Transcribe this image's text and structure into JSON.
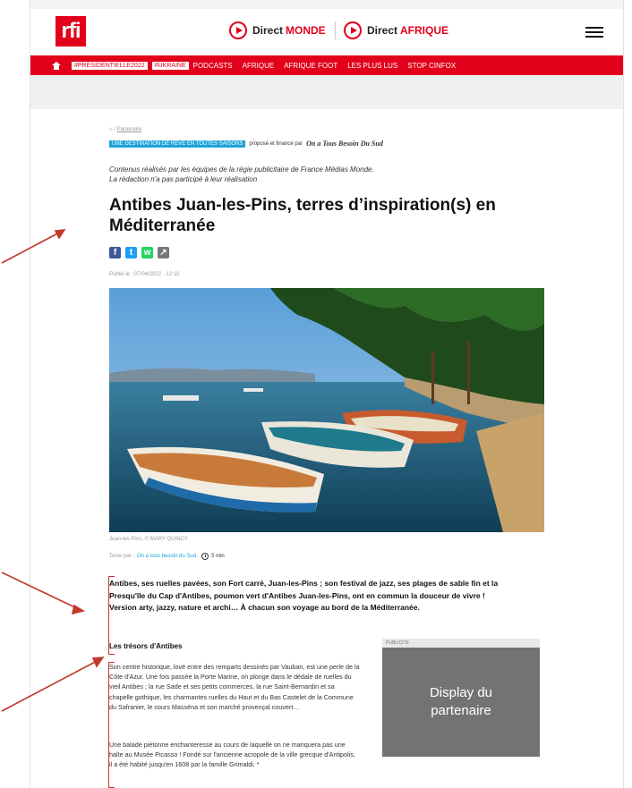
{
  "header": {
    "logo": "rfi",
    "direct_monde_prefix": "Direct",
    "direct_monde_name": "MONDE",
    "direct_afrique_prefix": "Direct",
    "direct_afrique_name": "AFRIQUE"
  },
  "nav": {
    "tags": [
      "#PRÉSIDENTIELLE2022",
      "#UKRAINE"
    ],
    "items": [
      "PODCASTS",
      "AFRIQUE",
      "AFRIQUE FOOT",
      "LES PLUS LUS",
      "STOP CINFOX"
    ]
  },
  "article": {
    "breadcrumb": "Partenaire",
    "sponsor_tag": "UNE DESTINATION DE RÊVE EN TOUTES SAISONS",
    "sponsor_text": "proposé et financé par",
    "sponsor_brand": "On a Tous Besoin Du Sud",
    "disclaimer_line1": "Contenus réalisés par les équipes de la régie publicitaire de France Médias Monde.",
    "disclaimer_line2": "La rédaction n'a pas participé à leur réalisation",
    "title": "Antibes Juan-les-Pins, terres d’inspiration(s) en Méditerranée",
    "published": "Publié le : 07/04/2022 - 12:10",
    "photo_caption": "Juan-les-Pins. © MARY QUINCY",
    "byline_prefix": "Texte par :",
    "byline_author": "On a tous besoin du Sud",
    "read_time": "5 min",
    "lede": "Antibes, ses ruelles pavées, son Fort carré, Juan-les-Pins ; son festival de jazz, ses plages de sable fin et la Presqu'île du Cap d'Antibes, poumon vert d'Antibes Juan-les-Pins, ont en commun la douceur de vivre ! Version arty, jazzy, nature et archi… À chacun son voyage au bord de la Méditerranée.",
    "subhead": "Les trésors d'Antibes",
    "paragraph1": "Son centre historique, lové entre des remparts dessinés par Vauban, est une perle de la Côte d'Azur. Une fois passée la Porte Marine, on plonge dans le dédale de ruelles du vieil Antibes ; la rue Sade et ses petits commerces, la rue Saint-Bernardin et sa chapelle gothique, les charmantes ruelles du Haut et du Bas Castelet de la Commune du Safranier, le cours Masséna et son marché provençal couvert…",
    "paragraph2": "Une balade piétonne enchanteresse au cours de laquelle on ne manquera pas une halte au Musée Picasso ! Fondé sur l'ancienne acropole de la ville grecque d'Antipolis, il a été habité jusqu'en 1608 par la famille Grimaldi. *"
  },
  "ad": {
    "label": "PUBLICITÉ",
    "text": "Display du partenaire"
  },
  "colors": {
    "brand_red": "#e2001a",
    "link_blue": "#1ca4d8",
    "annotation_red": "#c0392b"
  }
}
